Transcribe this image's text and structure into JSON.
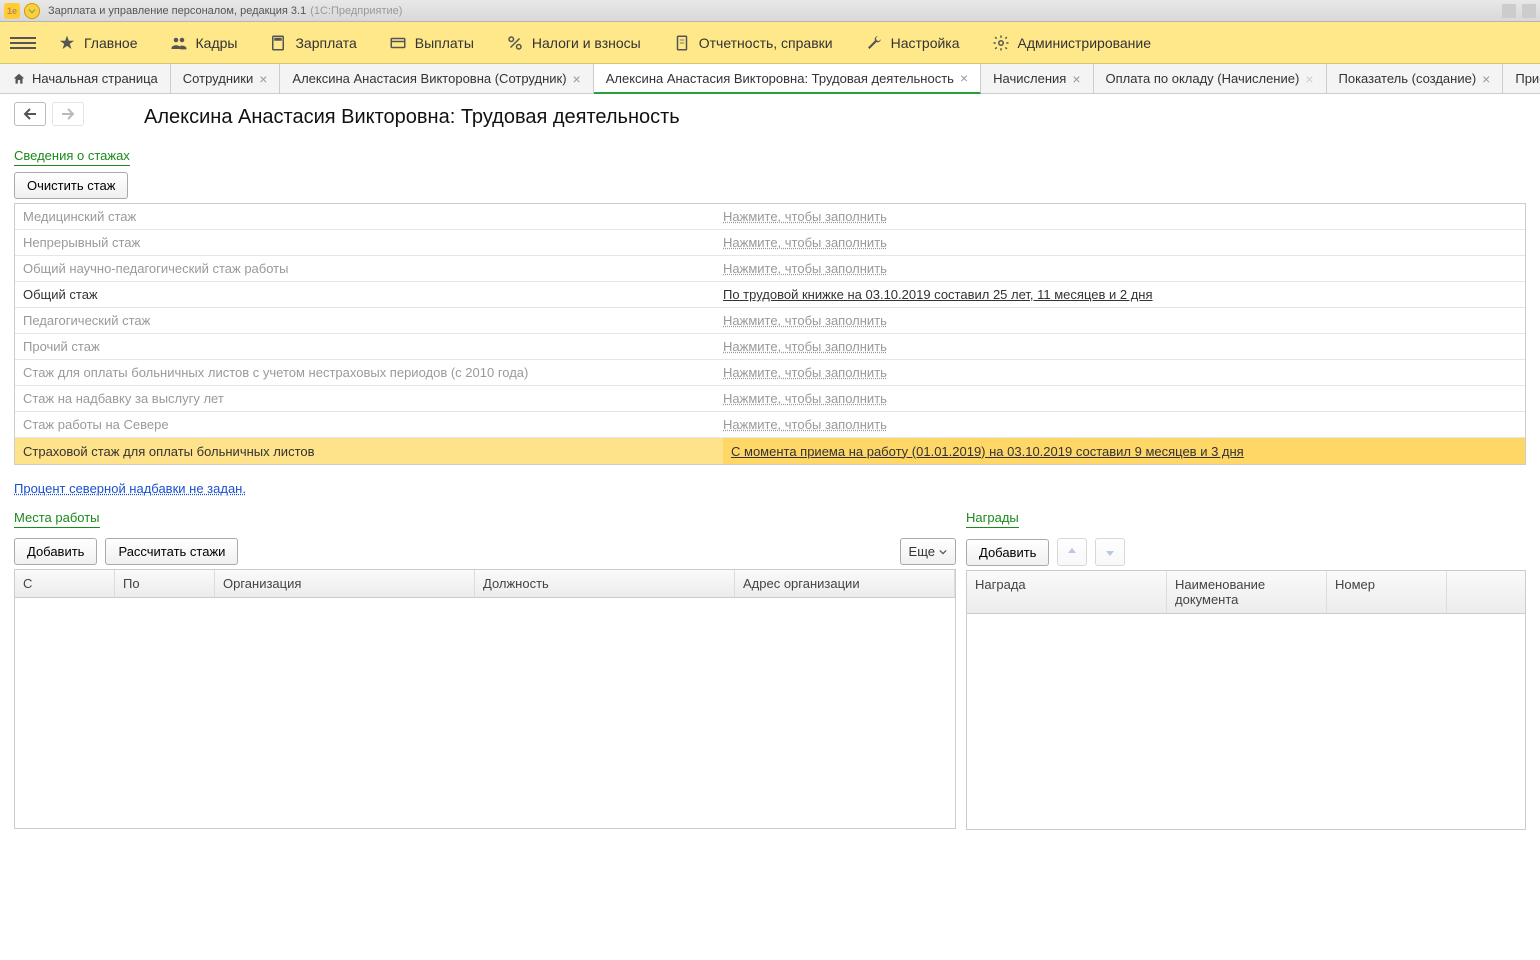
{
  "titlebar": {
    "title": "Зарплата и управление персоналом, редакция 3.1",
    "platform": "(1С:Предприятие)"
  },
  "mainmenu": [
    {
      "label": "Главное"
    },
    {
      "label": "Кадры"
    },
    {
      "label": "Зарплата"
    },
    {
      "label": "Выплаты"
    },
    {
      "label": "Налоги и взносы"
    },
    {
      "label": "Отчетность, справки"
    },
    {
      "label": "Настройка"
    },
    {
      "label": "Администрирование"
    }
  ],
  "tabs": [
    {
      "label": "Начальная страница",
      "home": true,
      "close": false
    },
    {
      "label": "Сотрудники",
      "close": true
    },
    {
      "label": "Алексина Анастасия Викторовна (Сотрудник)",
      "close": true
    },
    {
      "label": "Алексина Анастасия Викторовна: Трудовая деятельность",
      "close": true,
      "active": true
    },
    {
      "label": "Начисления",
      "close": true
    },
    {
      "label": "Оплата по окладу (Начисление)",
      "close": true,
      "dim": true
    },
    {
      "label": "Показатель (создание)",
      "close": true
    },
    {
      "label": "Прием на",
      "close": false
    }
  ],
  "page": {
    "title": "Алексина Анастасия Викторовна: Трудовая деятельность",
    "section_stazh": "Сведения о стажах",
    "clear_btn": "Очистить стаж",
    "fill_hint": "Нажмите, чтобы заполнить",
    "stazh_rows": [
      {
        "label": "Медицинский стаж"
      },
      {
        "label": "Непрерывный стаж"
      },
      {
        "label": "Общий научно-педагогический стаж работы"
      },
      {
        "label": "Общий стаж",
        "strong": true,
        "value": "По трудовой книжке на 03.10.2019 составил 25 лет, 11 месяцев и 2 дня"
      },
      {
        "label": "Педагогический стаж"
      },
      {
        "label": "Прочий стаж"
      },
      {
        "label": "Стаж для оплаты больничных листов с учетом нестраховых периодов (с 2010 года)"
      },
      {
        "label": "Стаж на надбавку за выслугу лет"
      },
      {
        "label": "Стаж работы на Севере"
      },
      {
        "label": "Страховой стаж для оплаты больничных листов",
        "highlight": true,
        "value": "С момента приема на работу (01.01.2019) на 03.10.2019 составил 9 месяцев и 3 дня"
      }
    ],
    "north_link": "Процент северной надбавки не задан.",
    "section_jobs": "Места работы",
    "add_btn": "Добавить",
    "recalc_btn": "Рассчитать стажи",
    "more_btn": "Еще",
    "jobs_cols": [
      "С",
      "По",
      "Организация",
      "Должность",
      "Адрес организации"
    ],
    "section_awards": "Награды",
    "awards_cols": [
      "Награда",
      "Наименование документа",
      "Номер"
    ]
  }
}
